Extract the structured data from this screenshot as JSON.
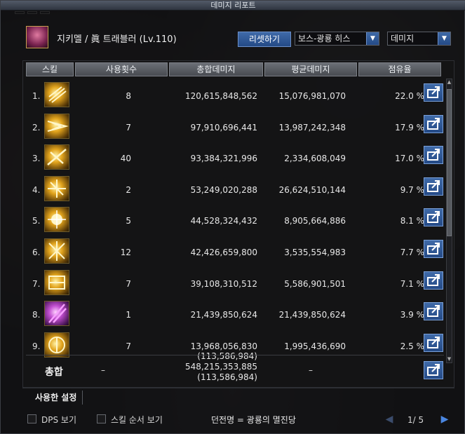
{
  "window": {
    "title": "데미지 리포트"
  },
  "character": {
    "name": "지키멜 / 眞 트래블러 (Lv.110)"
  },
  "controls": {
    "reset_label": "리셋하기",
    "boss_filter": "보스-광룡 히스",
    "metric_select": "데미지"
  },
  "table": {
    "headers": [
      "스킬",
      "사용횟수",
      "총합데미지",
      "평균데미지",
      "점유율"
    ],
    "rows": [
      {
        "rank": "1.",
        "count": "8",
        "total": "120,615,848,562",
        "avg": "15,076,981,070",
        "share": "22.0 %"
      },
      {
        "rank": "2.",
        "count": "7",
        "total": "97,910,696,441",
        "avg": "13,987,242,348",
        "share": "17.9 %"
      },
      {
        "rank": "3.",
        "count": "40",
        "total": "93,384,321,996",
        "avg": "2,334,608,049",
        "share": "17.0 %"
      },
      {
        "rank": "4.",
        "count": "2",
        "total": "53,249,020,288",
        "avg": "26,624,510,144",
        "share": "9.7 %"
      },
      {
        "rank": "5.",
        "count": "5",
        "total": "44,528,324,432",
        "avg": "8,905,664,886",
        "share": "8.1 %"
      },
      {
        "rank": "6.",
        "count": "12",
        "total": "42,426,659,800",
        "avg": "3,535,554,983",
        "share": "7.7 %"
      },
      {
        "rank": "7.",
        "count": "7",
        "total": "39,108,310,512",
        "avg": "5,586,901,501",
        "share": "7.1 %"
      },
      {
        "rank": "8.",
        "count": "1",
        "total": "21,439,850,624",
        "avg": "21,439,850,624",
        "share": "3.9 %"
      },
      {
        "rank": "9.",
        "count": "7",
        "total": "13,968,056,830",
        "total_sub": "(113,586,984)",
        "avg": "1,995,436,690",
        "share": "2.5 %"
      }
    ],
    "summary": {
      "label": "총합",
      "count": "–",
      "total": "548,215,353,885",
      "total_sub": "(113,586,984)",
      "avg": "–"
    },
    "settings_label": "사용한 설정"
  },
  "bottom": {
    "dps_label": "DPS 보기",
    "order_label": "스킬 순서 보기",
    "dungeon": "던전명 = 광룡의 멸진당",
    "page": "1/ 5"
  },
  "icons": [
    "skill-icon",
    "share-icon",
    "chevron-down-icon",
    "prev-page-icon",
    "next-page-icon"
  ]
}
